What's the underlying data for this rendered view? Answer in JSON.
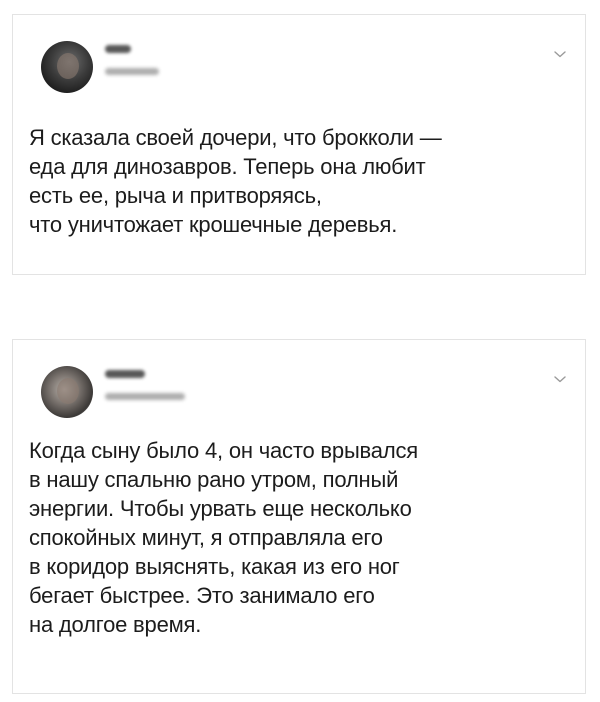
{
  "tweets": [
    {
      "lines": [
        "Я сказала своей дочери, что брокколи —",
        "еда для динозавров. Теперь она любит",
        "есть ее, рыча и притворяясь,",
        "что уничтожает крошечные деревья."
      ]
    },
    {
      "lines": [
        "Когда сыну было 4, он часто врывался",
        "в нашу спальню рано утром, полный",
        "энергии. Чтобы урвать еще несколько",
        "спокойных минут, я отправляла его",
        "в коридор выяснять, какая из его ног",
        "бегает быстрее. Это занимало его",
        "на долгое время."
      ]
    }
  ],
  "icons": {
    "menu": "chevron-down-icon"
  },
  "colors": {
    "text": "#1c1c1c",
    "border": "#e3e3e3",
    "chevron": "#9a9a9a"
  }
}
